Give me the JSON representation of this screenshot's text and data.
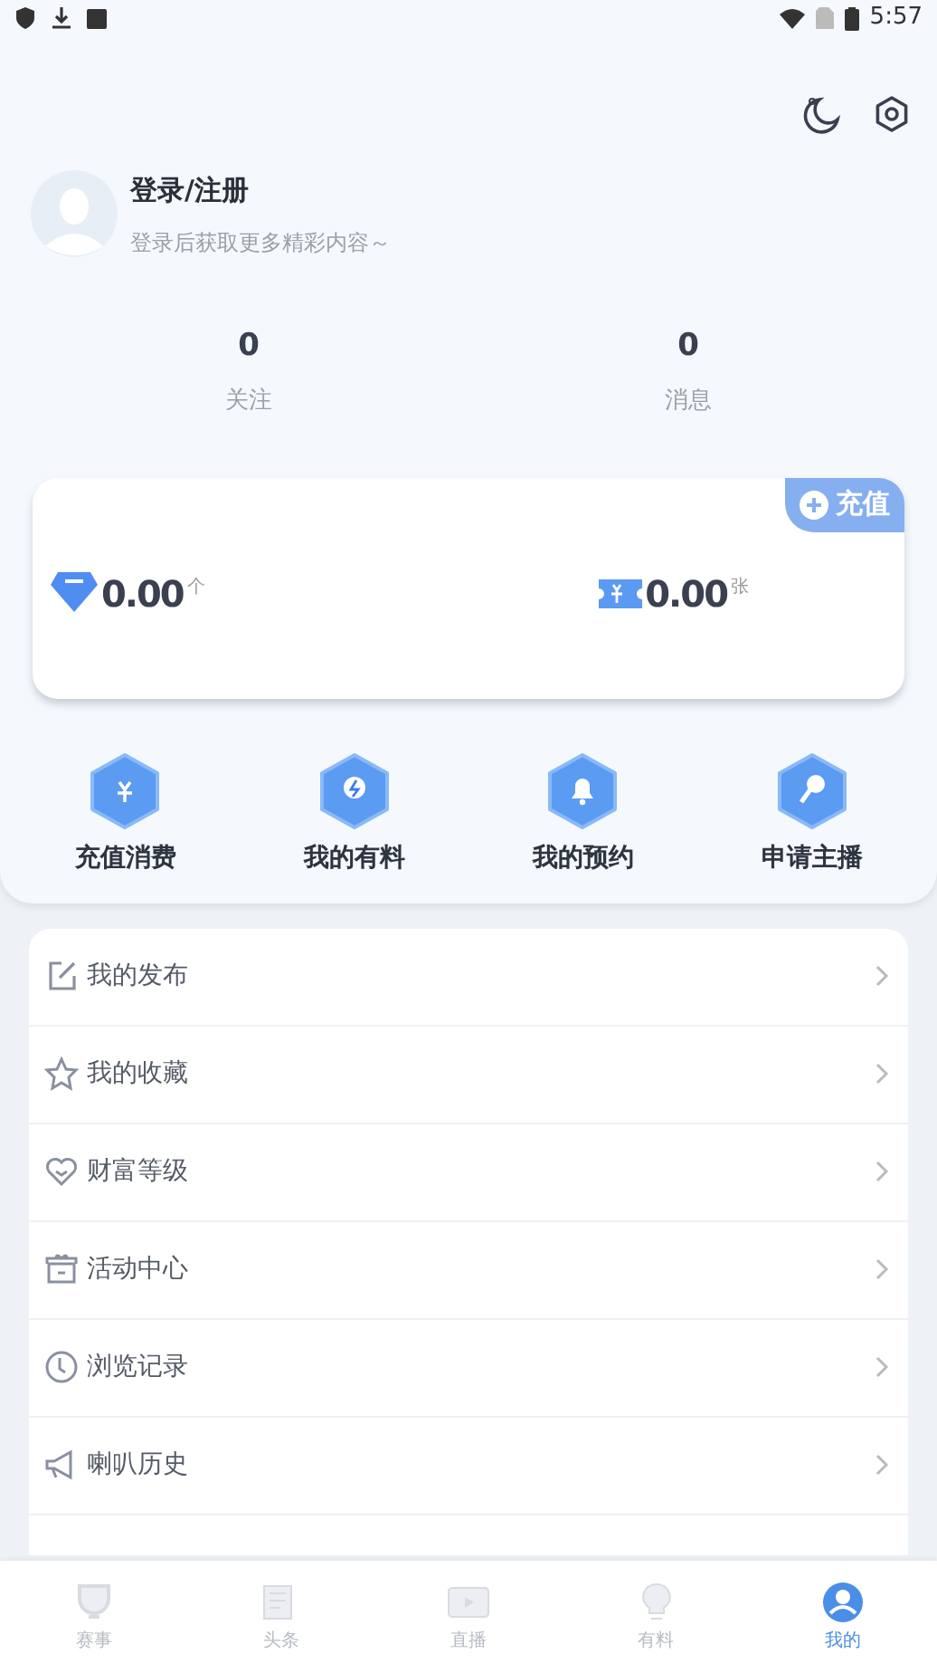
{
  "status_bar": {
    "time": "5:57"
  },
  "header": {
    "title": "登录/注册",
    "subtitle": "登录后获取更多精彩内容～"
  },
  "stats": [
    {
      "value": "0",
      "label": "关注"
    },
    {
      "value": "0",
      "label": "消息"
    }
  ],
  "wallet": {
    "recharge_button": "充值",
    "balances": [
      {
        "kind": "diamond",
        "value": "0.00",
        "unit": "个"
      },
      {
        "kind": "ticket",
        "value": "0.00",
        "unit": "张"
      }
    ]
  },
  "shortcuts": [
    {
      "kind": "yuan",
      "label": "充值消费"
    },
    {
      "kind": "bulb",
      "label": "我的有料"
    },
    {
      "kind": "bell",
      "label": "我的预约"
    },
    {
      "kind": "mic",
      "label": "申请主播"
    }
  ],
  "menu": [
    {
      "kind": "edit",
      "label": "我的发布"
    },
    {
      "kind": "star",
      "label": "我的收藏"
    },
    {
      "kind": "heart",
      "label": "财富等级"
    },
    {
      "kind": "gift",
      "label": "活动中心"
    },
    {
      "kind": "clock",
      "label": "浏览记录"
    },
    {
      "kind": "horn",
      "label": "喇叭历史"
    }
  ],
  "tab_bar": [
    {
      "kind": "trophy",
      "label": "赛事",
      "selected": false
    },
    {
      "kind": "news",
      "label": "头条",
      "selected": false
    },
    {
      "kind": "video",
      "label": "直播",
      "selected": false
    },
    {
      "kind": "bulb",
      "label": "有料",
      "selected": false
    },
    {
      "kind": "user",
      "label": "我的",
      "selected": true
    }
  ]
}
